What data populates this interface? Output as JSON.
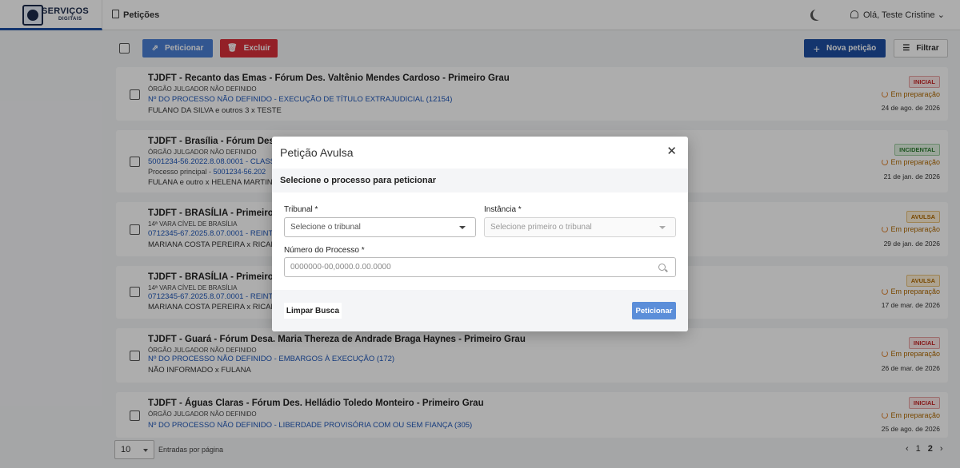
{
  "app": {
    "logo_line1": "SERVIÇOS",
    "logo_line2": "DIGITAIS",
    "nav_peticoes": "Petições",
    "greeting": "Olá, Teste Cristine"
  },
  "toolbar": {
    "peticionar": "Peticionar",
    "excluir": "Excluir",
    "nova_peticao": "Nova petição",
    "filtrar": "Filtrar"
  },
  "cards": [
    {
      "title": "TJDFT - Recanto das Emas - Fórum Des. Valtênio Mendes Cardoso - Primeiro Grau",
      "orgao": "ÓRGÃO JULGADOR NÃO DEFINIDO",
      "link": "Nº DO PROCESSO NÃO DEFINIDO - EXECUÇÃO DE TÍTULO EXTRAJUDICIAL (12154)",
      "parts": "FULANO DA SILVA e outros 3 x TESTE",
      "badge": "INICIAL",
      "status": "Em preparação",
      "date": "24 de ago. de 2026"
    },
    {
      "title": "TJDFT - Brasília - Fórum Des. Jo",
      "orgao": "ÓRGÃO JULGADOR NÃO DEFINIDO",
      "link": "5001234-56.2022.8.08.0001 - CLASSE",
      "proc_label": "Processo principal - ",
      "proc_link": "5001234-56.202",
      "parts": "FULANA e outro x HELENA MARTINS",
      "badge": "INCIDENTAL",
      "status": "Em preparação",
      "date": "21 de jan. de 2026"
    },
    {
      "title": "TJDFT - BRASÍLIA - Primeiro Gra",
      "orgao": "14ª VARA CÍVEL DE BRASÍLIA",
      "link": "0712345-67.2025.8.07.0001 - REINTEG",
      "parts": "MARIANA COSTA PEREIRA x RICARD",
      "badge": "AVULSA",
      "status": "Em preparação",
      "date": "29 de jan. de 2026"
    },
    {
      "title": "TJDFT - BRASÍLIA - Primeiro Gra",
      "orgao": "14ª VARA CÍVEL DE BRASÍLIA",
      "link": "0712345-67.2025.8.07.0001 - REINTEG",
      "parts": "MARIANA COSTA PEREIRA x RICARD",
      "badge": "AVULSA",
      "status": "Em preparação",
      "date": "17 de mar. de 2026"
    },
    {
      "title": "TJDFT - Guará - Fórum Desa. Maria Thereza de Andrade Braga Haynes - Primeiro Grau",
      "orgao": "ÓRGÃO JULGADOR NÃO DEFINIDO",
      "link": "Nº DO PROCESSO NÃO DEFINIDO - EMBARGOS À EXECUÇÃO (172)",
      "parts": "NÃO INFORMADO x FULANA",
      "badge": "INICIAL",
      "status": "Em preparação",
      "date": "26 de mar. de 2026"
    },
    {
      "title": "TJDFT - Águas Claras - Fórum Des. Helládio Toledo Monteiro - Primeiro Grau",
      "orgao": "ÓRGÃO JULGADOR NÃO DEFINIDO",
      "link": "Nº DO PROCESSO NÃO DEFINIDO - LIBERDADE PROVISÓRIA COM OU SEM FIANÇA (305)",
      "badge": "INICIAL",
      "status": "Em preparação",
      "date": "25 de ago. de 2026"
    }
  ],
  "footer": {
    "per_page": "10",
    "per_page_label": "Entradas por página",
    "pages": [
      "1",
      "2"
    ]
  },
  "modal": {
    "title": "Petição Avulsa",
    "subtitle": "Selecione o processo para peticionar",
    "tribunal_label": "Tribunal *",
    "tribunal_placeholder": "Selecione o tribunal",
    "instancia_label": "Instância *",
    "instancia_placeholder": "Selecione primeiro o tribunal",
    "numero_label": "Número do Processo *",
    "numero_placeholder": "0000000-00,0000.0.00.0000",
    "clear": "Limpar Busca",
    "submit": "Peticionar"
  }
}
